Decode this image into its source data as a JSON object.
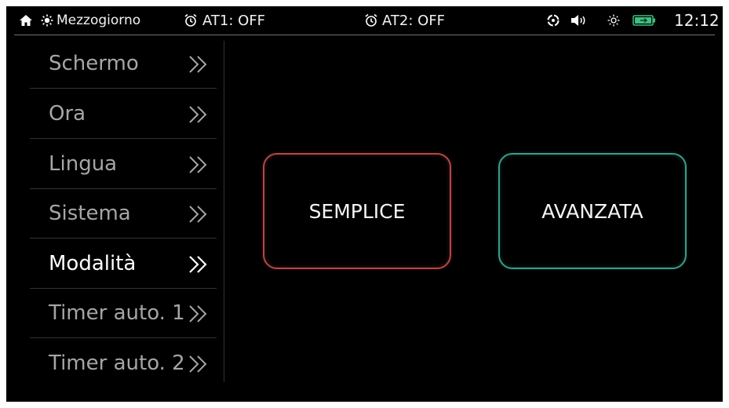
{
  "status_bar": {
    "home_icon": "home-icon",
    "weather_icon": "sun-icon",
    "weather_label": "Mezzogiorno",
    "alarm1_label": "AT1: OFF",
    "alarm2_label": "AT2: OFF",
    "icons": [
      "fan-icon",
      "speaker-icon",
      "brightness-icon",
      "battery-icon"
    ],
    "time": "12:12"
  },
  "sidebar": {
    "active_index": 4,
    "items": [
      {
        "label": "Schermo"
      },
      {
        "label": "Ora"
      },
      {
        "label": "Lingua"
      },
      {
        "label": "Sistema"
      },
      {
        "label": "Modalità"
      },
      {
        "label": "Timer auto. 1"
      },
      {
        "label": "Timer auto. 2"
      }
    ]
  },
  "main": {
    "simple_label": "SEMPLICE",
    "advanced_label": "AVANZATA"
  },
  "colors": {
    "background": "#000000",
    "simple_border": "#b34848",
    "advanced_border": "#3a9c88",
    "battery": "#3fbf7f",
    "inactive_text": "#a6a6a6",
    "active_text": "#ffffff"
  }
}
